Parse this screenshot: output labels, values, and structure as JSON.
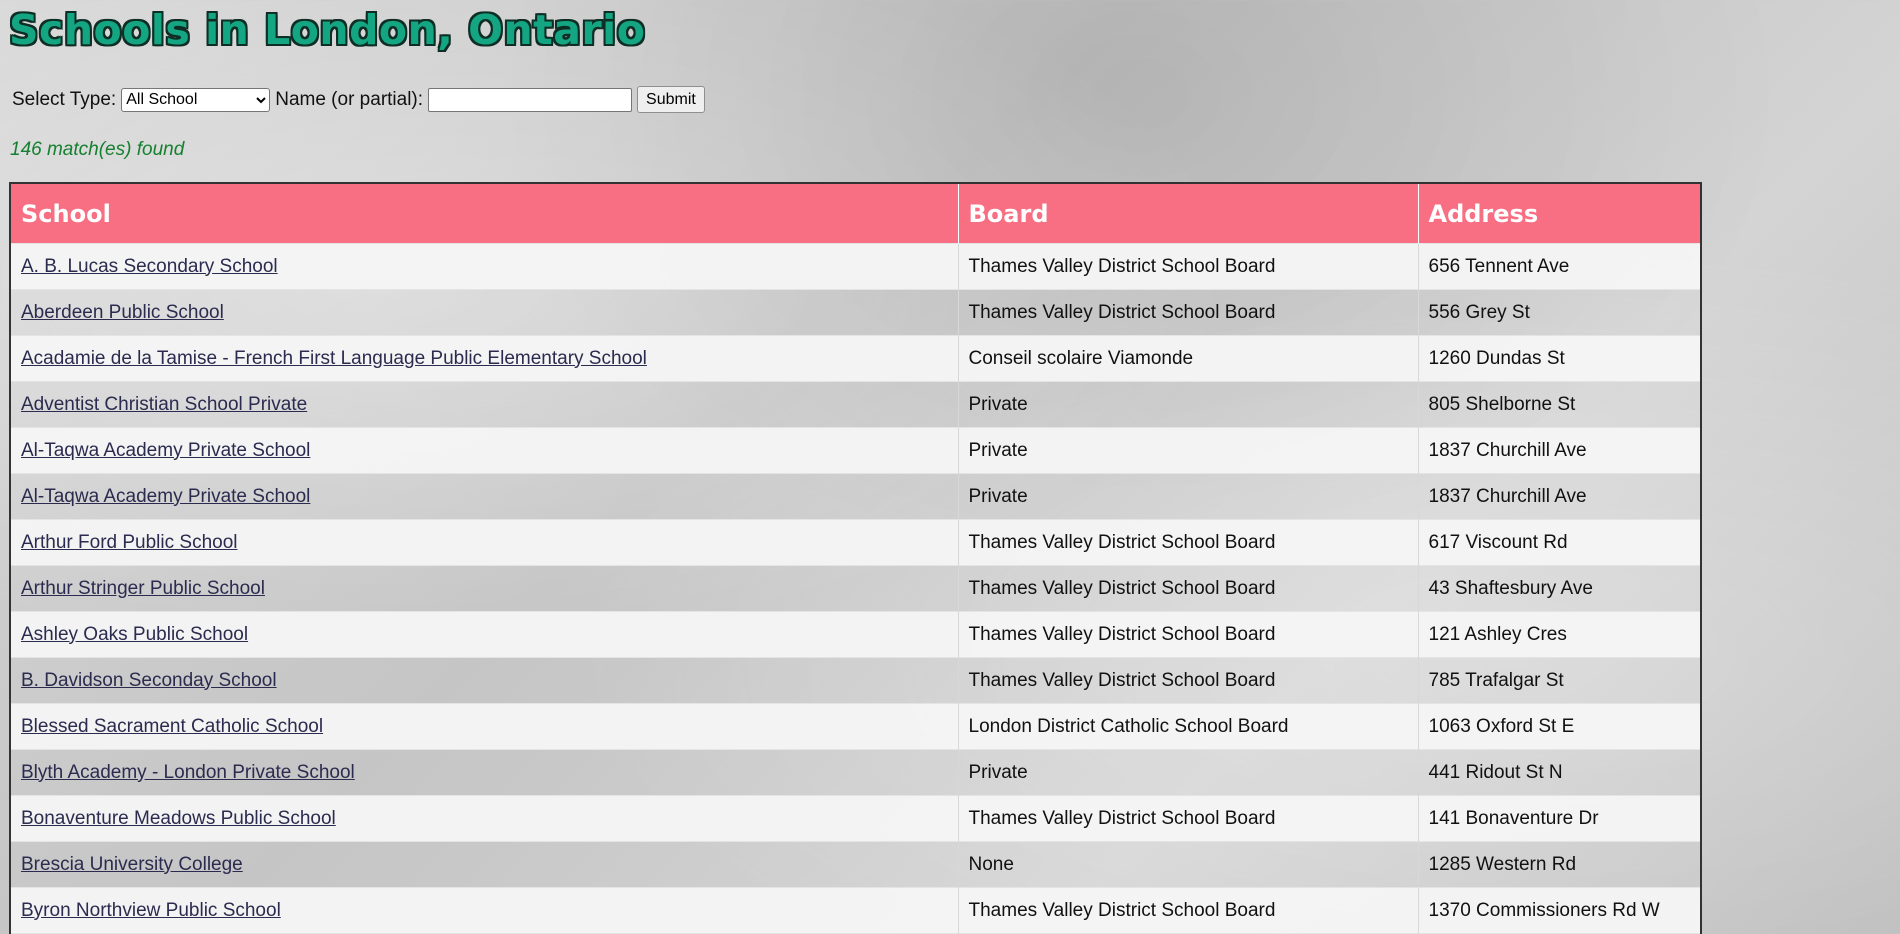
{
  "page": {
    "title": "Schools in London, Ontario"
  },
  "form": {
    "type_label": "Select Type:",
    "type_selected": "All School",
    "name_label": "Name (or partial):",
    "name_value": "",
    "submit_label": "Submit"
  },
  "results": {
    "match_text": "146 match(es) found"
  },
  "table": {
    "headers": [
      "School",
      "Board",
      "Address"
    ],
    "rows": [
      {
        "school": "A. B. Lucas Secondary School",
        "board": "Thames Valley District School Board",
        "address": "656 Tennent Ave"
      },
      {
        "school": "Aberdeen Public School",
        "board": "Thames Valley District School Board",
        "address": "556 Grey St"
      },
      {
        "school": "Acadamie de la Tamise - French First Language Public Elementary School",
        "board": "Conseil scolaire Viamonde",
        "address": "1260 Dundas St"
      },
      {
        "school": "Adventist Christian School Private",
        "board": "Private",
        "address": "805 Shelborne St"
      },
      {
        "school": "Al-Taqwa Academy Private School",
        "board": "Private",
        "address": "1837 Churchill Ave"
      },
      {
        "school": "Al-Taqwa Academy Private School",
        "board": "Private",
        "address": "1837 Churchill Ave"
      },
      {
        "school": "Arthur Ford Public School",
        "board": "Thames Valley District School Board",
        "address": "617 Viscount Rd"
      },
      {
        "school": "Arthur Stringer Public School",
        "board": "Thames Valley District School Board",
        "address": "43 Shaftesbury Ave"
      },
      {
        "school": "Ashley Oaks Public School",
        "board": "Thames Valley District School Board",
        "address": "121 Ashley Cres"
      },
      {
        "school": "B. Davidson Seconday School",
        "board": "Thames Valley District School Board",
        "address": "785 Trafalgar St"
      },
      {
        "school": "Blessed Sacrament Catholic School",
        "board": "London District Catholic School Board",
        "address": "1063 Oxford St E"
      },
      {
        "school": "Blyth Academy - London Private School",
        "board": "Private",
        "address": "441 Ridout St N"
      },
      {
        "school": "Bonaventure Meadows Public School",
        "board": "Thames Valley District School Board",
        "address": "141 Bonaventure Dr"
      },
      {
        "school": "Brescia University College",
        "board": "None",
        "address": "1285 Western Rd"
      },
      {
        "school": "Byron Northview Public School",
        "board": "Thames Valley District School Board",
        "address": "1370 Commissioners Rd W"
      },
      {
        "school": "",
        "board": "",
        "address": ""
      }
    ]
  }
}
